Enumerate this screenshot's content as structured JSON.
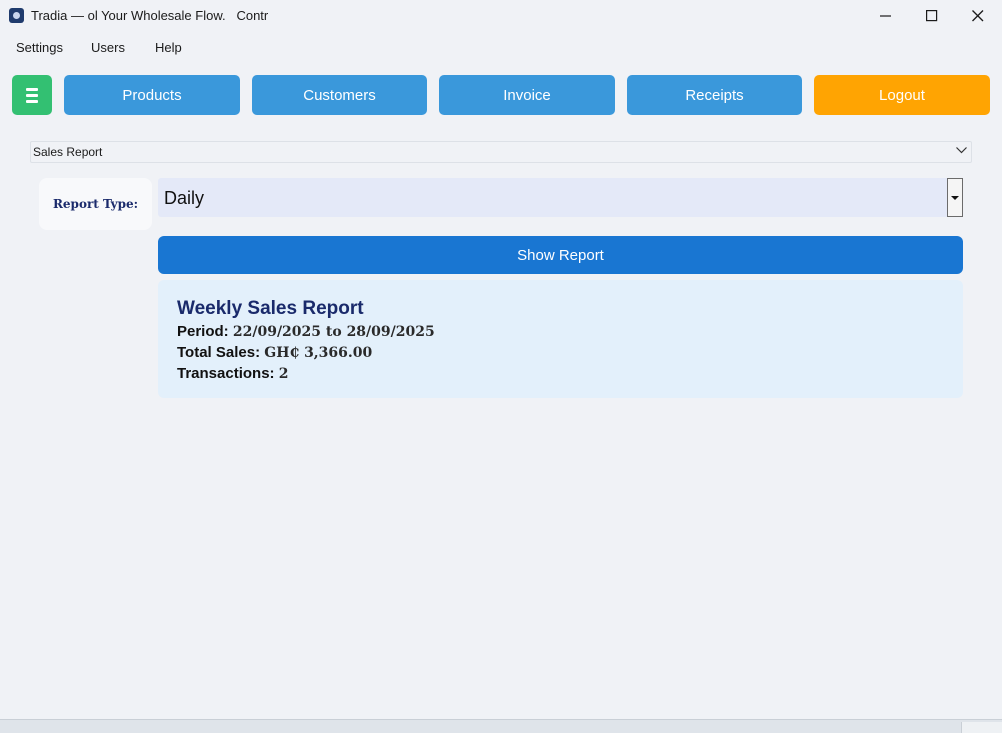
{
  "window": {
    "title": "Tradia — ol Your Wholesale Flow.   Contr"
  },
  "menu": {
    "items": [
      "Settings",
      "Users",
      "Help"
    ]
  },
  "toolbar": {
    "products": "Products",
    "customers": "Customers",
    "invoice": "Invoice",
    "receipts": "Receipts",
    "logout": "Logout",
    "colors": {
      "nav": "#3a98db",
      "logout": "#ffa402",
      "menu": "#33c072"
    }
  },
  "report_select": {
    "value": "Sales Report"
  },
  "report_type": {
    "label": "Report Type:",
    "value": "Daily"
  },
  "show_report": {
    "label": "Show Report",
    "color": "#1976d2"
  },
  "report": {
    "title": "Weekly Sales Report",
    "period_label": "Period:",
    "period_value": "22/09/2025 to 28/09/2025",
    "total_label": "Total Sales:",
    "total_value": "GH₵ 3,366.00",
    "transactions_label": "Transactions:",
    "transactions_value": "2"
  }
}
